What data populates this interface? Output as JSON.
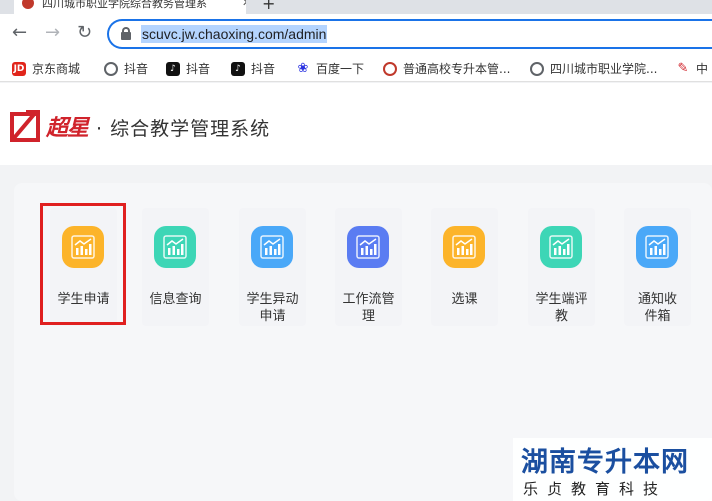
{
  "browser": {
    "tab_title": "四川城市职业学院综合教务管理系",
    "tab_close": "✕",
    "new_tab": "+",
    "url": "scuvc.jw.chaoxing.com/admin"
  },
  "bookmarks": [
    {
      "label": "京东商城",
      "icon": "JD",
      "color": "#e1251b"
    },
    {
      "label": "抖音",
      "icon": "globe",
      "color": "#5f6368"
    },
    {
      "label": "抖音",
      "icon": "tiktok",
      "color": "#111111"
    },
    {
      "label": "抖音",
      "icon": "tiktok",
      "color": "#111111"
    },
    {
      "label": "百度一下",
      "icon": "baidu-paw",
      "color": "#2932e1"
    },
    {
      "label": "普通高校专升本管...",
      "icon": "seal",
      "color": "#c0392b"
    },
    {
      "label": "四川城市职业学院...",
      "icon": "globe",
      "color": "#5f6368"
    },
    {
      "label": "中",
      "icon": "feather",
      "color": "#d0232b"
    }
  ],
  "header": {
    "logo_text": "超星",
    "system_title": "· 综合教学管理系统"
  },
  "modules": [
    {
      "label": "学生申请",
      "color": "#fcb42a"
    },
    {
      "label": "信息查询",
      "color": "#3dd6b6"
    },
    {
      "label": "学生异动\n申请",
      "color": "#4aa8f8"
    },
    {
      "label": "工作流管\n理",
      "color": "#5a7cf2"
    },
    {
      "label": "选课",
      "color": "#fcb42a"
    },
    {
      "label": "学生端评\n教",
      "color": "#3dd6b6"
    },
    {
      "label": "通知收\n件箱",
      "color": "#4aa8f8"
    }
  ],
  "watermark": {
    "title": "湖南专升本网",
    "subtitle": "乐贞教育科技"
  }
}
